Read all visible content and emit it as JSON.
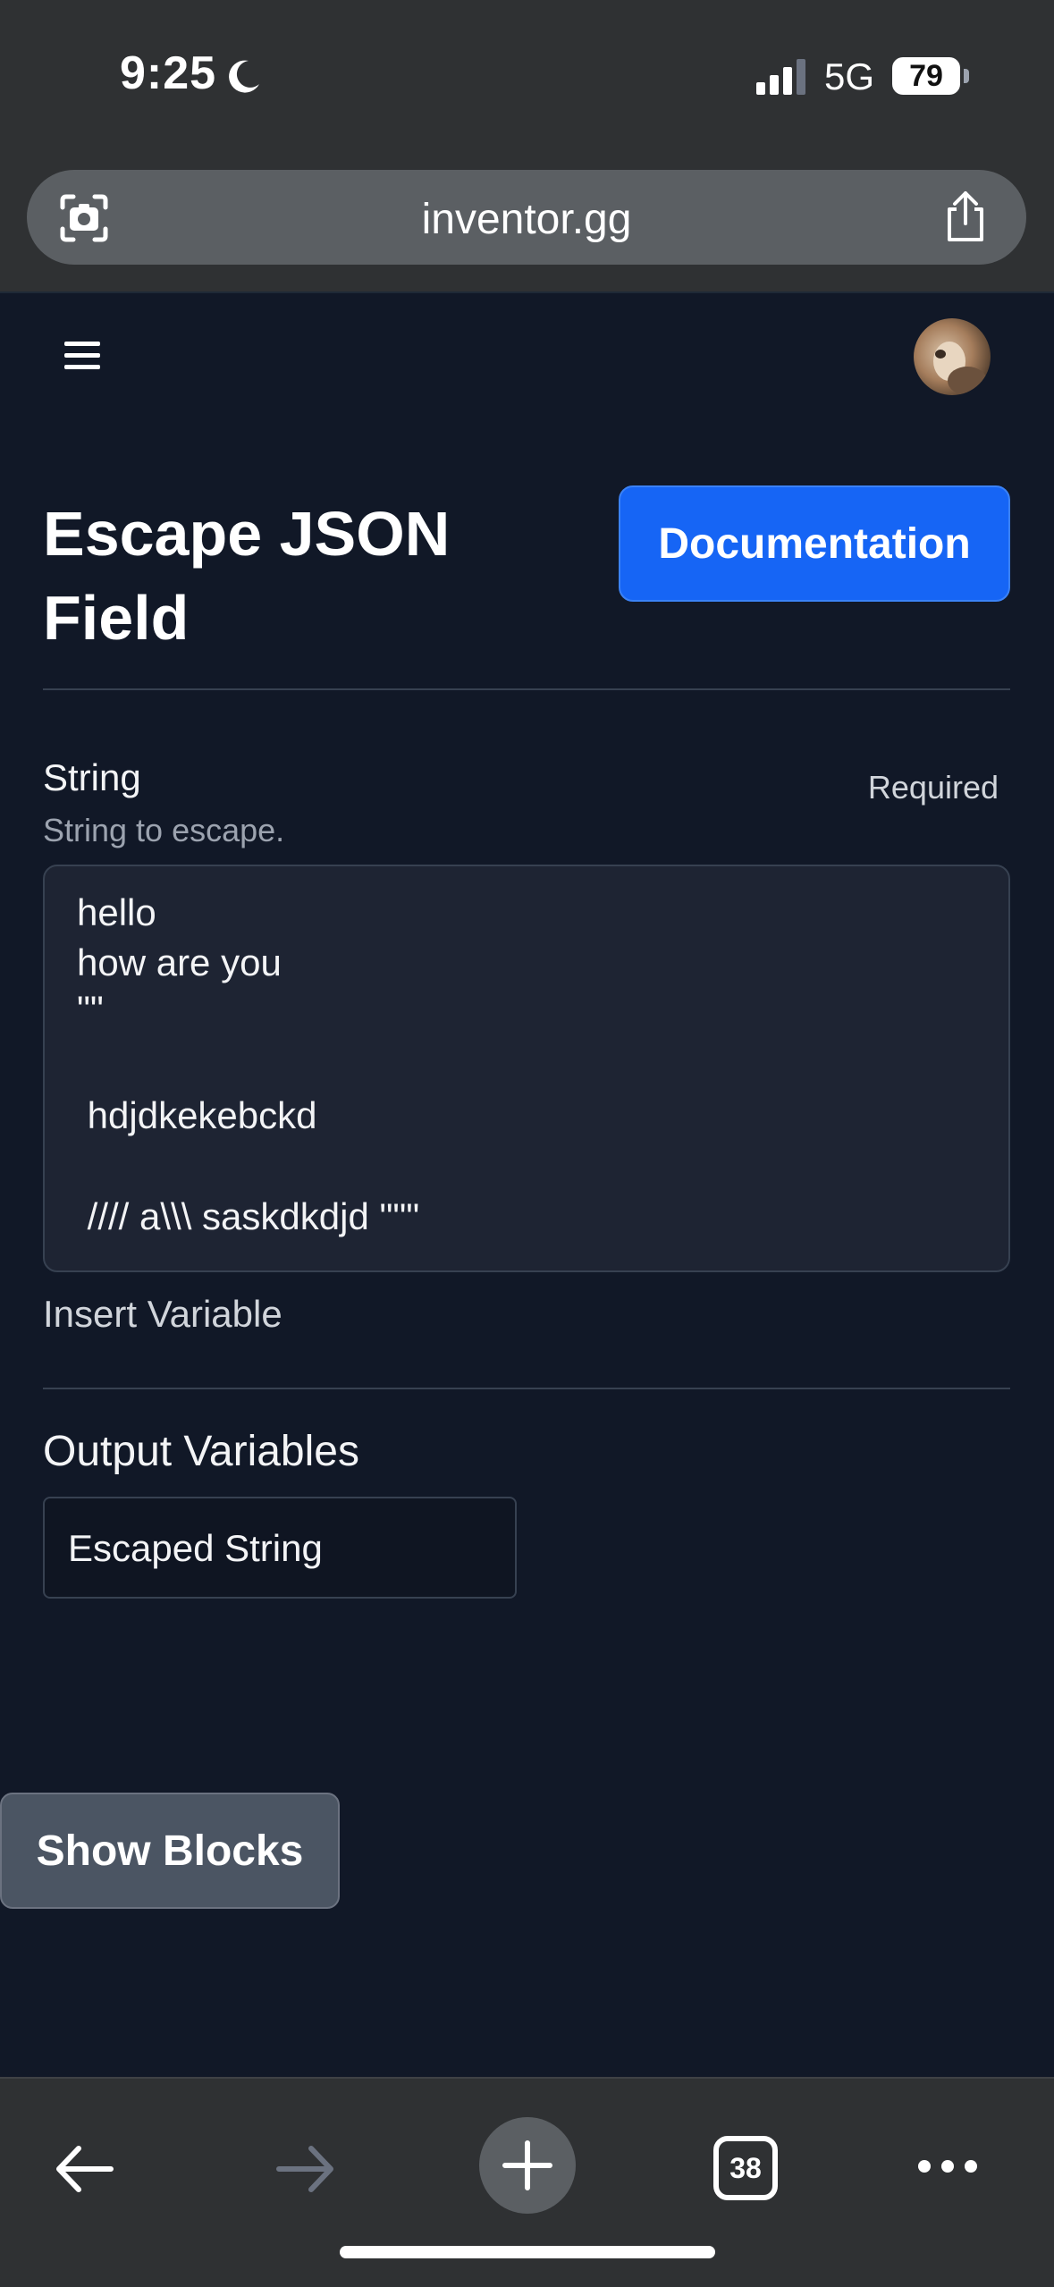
{
  "status_bar": {
    "time": "9:25",
    "network": "5G",
    "battery": "79"
  },
  "browser": {
    "url": "inventor.gg",
    "tab_count": "38"
  },
  "page": {
    "title": "Escape JSON Field",
    "documentation_button": "Documentation",
    "field": {
      "label": "String",
      "required": "Required",
      "description": "String to escape.",
      "value_lines": [
        "hello",
        "how are you",
        "\"\"",
        "",
        " hdjdkekebckd",
        "",
        " //// a\\\\\\ saskdkdjd \"\"\""
      ]
    },
    "insert_variable": "Insert Variable",
    "output": {
      "heading": "Output Variables",
      "variables": [
        "Escaped String"
      ]
    },
    "show_blocks_button": "Show Blocks"
  },
  "colors": {
    "page_background": "#111827",
    "primary_button": "#1665f5",
    "secondary_button": "#4b5563",
    "browser_chrome": "#2f3133"
  },
  "icons": [
    "moon-icon",
    "signal-icon",
    "camera-icon",
    "share-icon",
    "menu-icon",
    "back-arrow-icon",
    "forward-arrow-icon",
    "plus-icon",
    "tabs-icon",
    "more-icon"
  ]
}
